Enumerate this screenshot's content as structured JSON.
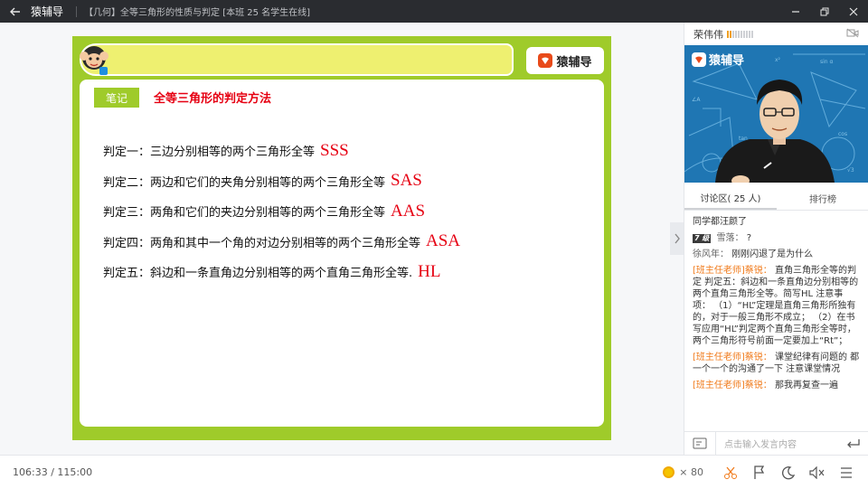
{
  "window": {
    "app_name": "猿辅导",
    "lesson_title": "【几何】全等三角形的性质与判定 [本班 25 名学生在线]"
  },
  "slide": {
    "brand": "猿辅导",
    "note_tag": "笔记",
    "note_title": "全等三角形的判定方法",
    "rules": [
      {
        "text": "判定一：三边分别相等的两个三角形全等",
        "abbr": "SSS"
      },
      {
        "text": "判定二：两边和它们的夹角分别相等的两个三角形全等",
        "abbr": "SAS"
      },
      {
        "text": "判定三：两角和它们的夹边分别相等的两个三角形全等",
        "abbr": "AAS"
      },
      {
        "text": "判定四：两角和其中一个角的对边分别相等的两个三角形全等",
        "abbr": "ASA"
      },
      {
        "text": "判定五：斜边和一条直角边分别相等的两个直角三角形全等.",
        "abbr": "HL"
      }
    ]
  },
  "panel": {
    "teacher_name": "荣伟伟",
    "video_brand": "猿辅导",
    "tabs": [
      "讨论区( 25 人)",
      "排行榜"
    ],
    "messages": [
      {
        "sender": "",
        "level": "",
        "text": "同学都汪颜了"
      },
      {
        "sender": "雪落：",
        "level": "7 级",
        "text": "?"
      },
      {
        "sender": "徐风年：",
        "level": "",
        "text": "刚刚闪退了是为什么"
      },
      {
        "sender": "[班主任老师]蔡锐：",
        "level": "",
        "teacher": true,
        "text": "直角三角形全等的判定 判定五：斜边和一条直角边分别相等的两个直角三角形全等。简写HL 注意事项： （1）“HL”定理是直角三角形所独有的，对于一般三角形不成立； （2）在书写应用“HL”判定两个直角三角形全等时，两个三角形符号前面一定要加上“Rt”；"
      },
      {
        "sender": "[班主任老师]蔡锐：",
        "level": "",
        "teacher": true,
        "text": "课堂纪律有问题的 都一个一个的沟通了一下 注意课堂情况"
      },
      {
        "sender": "[班主任老师]蔡锐：",
        "level": "",
        "teacher": true,
        "text": "那我再复查一遍"
      }
    ],
    "input_placeholder": "点击输入发言内容"
  },
  "bottom": {
    "timecode": "106:33 / 115:00",
    "coins_label": "× 80"
  },
  "colors": {
    "accent_green": "#9fcb2a",
    "rule_red": "#e60012",
    "teacher_orange": "#f07a1a",
    "titlebar": "#2a2c30"
  }
}
